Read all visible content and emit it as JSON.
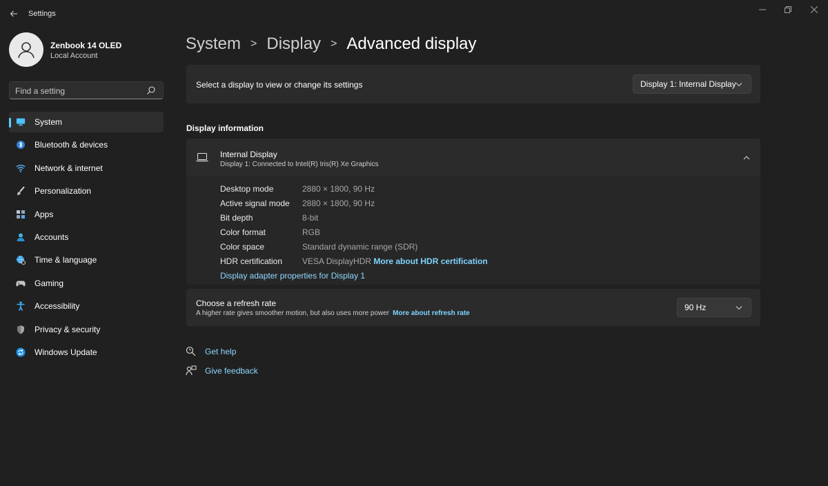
{
  "window": {
    "title": "Settings",
    "controls": [
      "minimize",
      "restore",
      "close"
    ]
  },
  "profile": {
    "name": "Zenbook 14 OLED",
    "account_type": "Local Account"
  },
  "search": {
    "placeholder": "Find a setting"
  },
  "sidebar": {
    "items": [
      {
        "label": "System",
        "icon": "monitor-icon",
        "active": true
      },
      {
        "label": "Bluetooth & devices",
        "icon": "bluetooth-icon",
        "active": false
      },
      {
        "label": "Network & internet",
        "icon": "wifi-icon",
        "active": false
      },
      {
        "label": "Personalization",
        "icon": "brush-icon",
        "active": false
      },
      {
        "label": "Apps",
        "icon": "apps-icon",
        "active": false
      },
      {
        "label": "Accounts",
        "icon": "person-icon",
        "active": false
      },
      {
        "label": "Time & language",
        "icon": "globe-clock-icon",
        "active": false
      },
      {
        "label": "Gaming",
        "icon": "gamepad-icon",
        "active": false
      },
      {
        "label": "Accessibility",
        "icon": "accessibility-icon",
        "active": false
      },
      {
        "label": "Privacy & security",
        "icon": "shield-icon",
        "active": false
      },
      {
        "label": "Windows Update",
        "icon": "update-icon",
        "active": false
      }
    ]
  },
  "breadcrumb": {
    "items": [
      "System",
      "Display",
      "Advanced display"
    ]
  },
  "display_select": {
    "label": "Select a display to view or change its settings",
    "value": "Display 1: Internal Display"
  },
  "display_info": {
    "section_title": "Display information",
    "header_title": "Internal Display",
    "header_subtitle": "Display 1: Connected to Intel(R) Iris(R) Xe Graphics",
    "rows": [
      {
        "key": "Desktop mode",
        "value": "2880 × 1800, 90 Hz"
      },
      {
        "key": "Active signal mode",
        "value": "2880 × 1800, 90 Hz"
      },
      {
        "key": "Bit depth",
        "value": "8-bit"
      },
      {
        "key": "Color format",
        "value": "RGB"
      },
      {
        "key": "Color space",
        "value": "Standard dynamic range (SDR)"
      },
      {
        "key": "HDR certification",
        "value": "VESA DisplayHDR",
        "link": "More about HDR certification"
      }
    ],
    "adapter_link": "Display adapter properties for Display 1"
  },
  "refresh_rate": {
    "title": "Choose a refresh rate",
    "subtitle": "A higher rate gives smoother motion, but also uses more power",
    "link": "More about refresh rate",
    "value": "90 Hz"
  },
  "help": {
    "get_help": "Get help",
    "give_feedback": "Give feedback"
  },
  "colors": {
    "background": "#202020",
    "card": "#2b2b2b",
    "accent": "#60cdff",
    "link": "#8fd8ff"
  }
}
